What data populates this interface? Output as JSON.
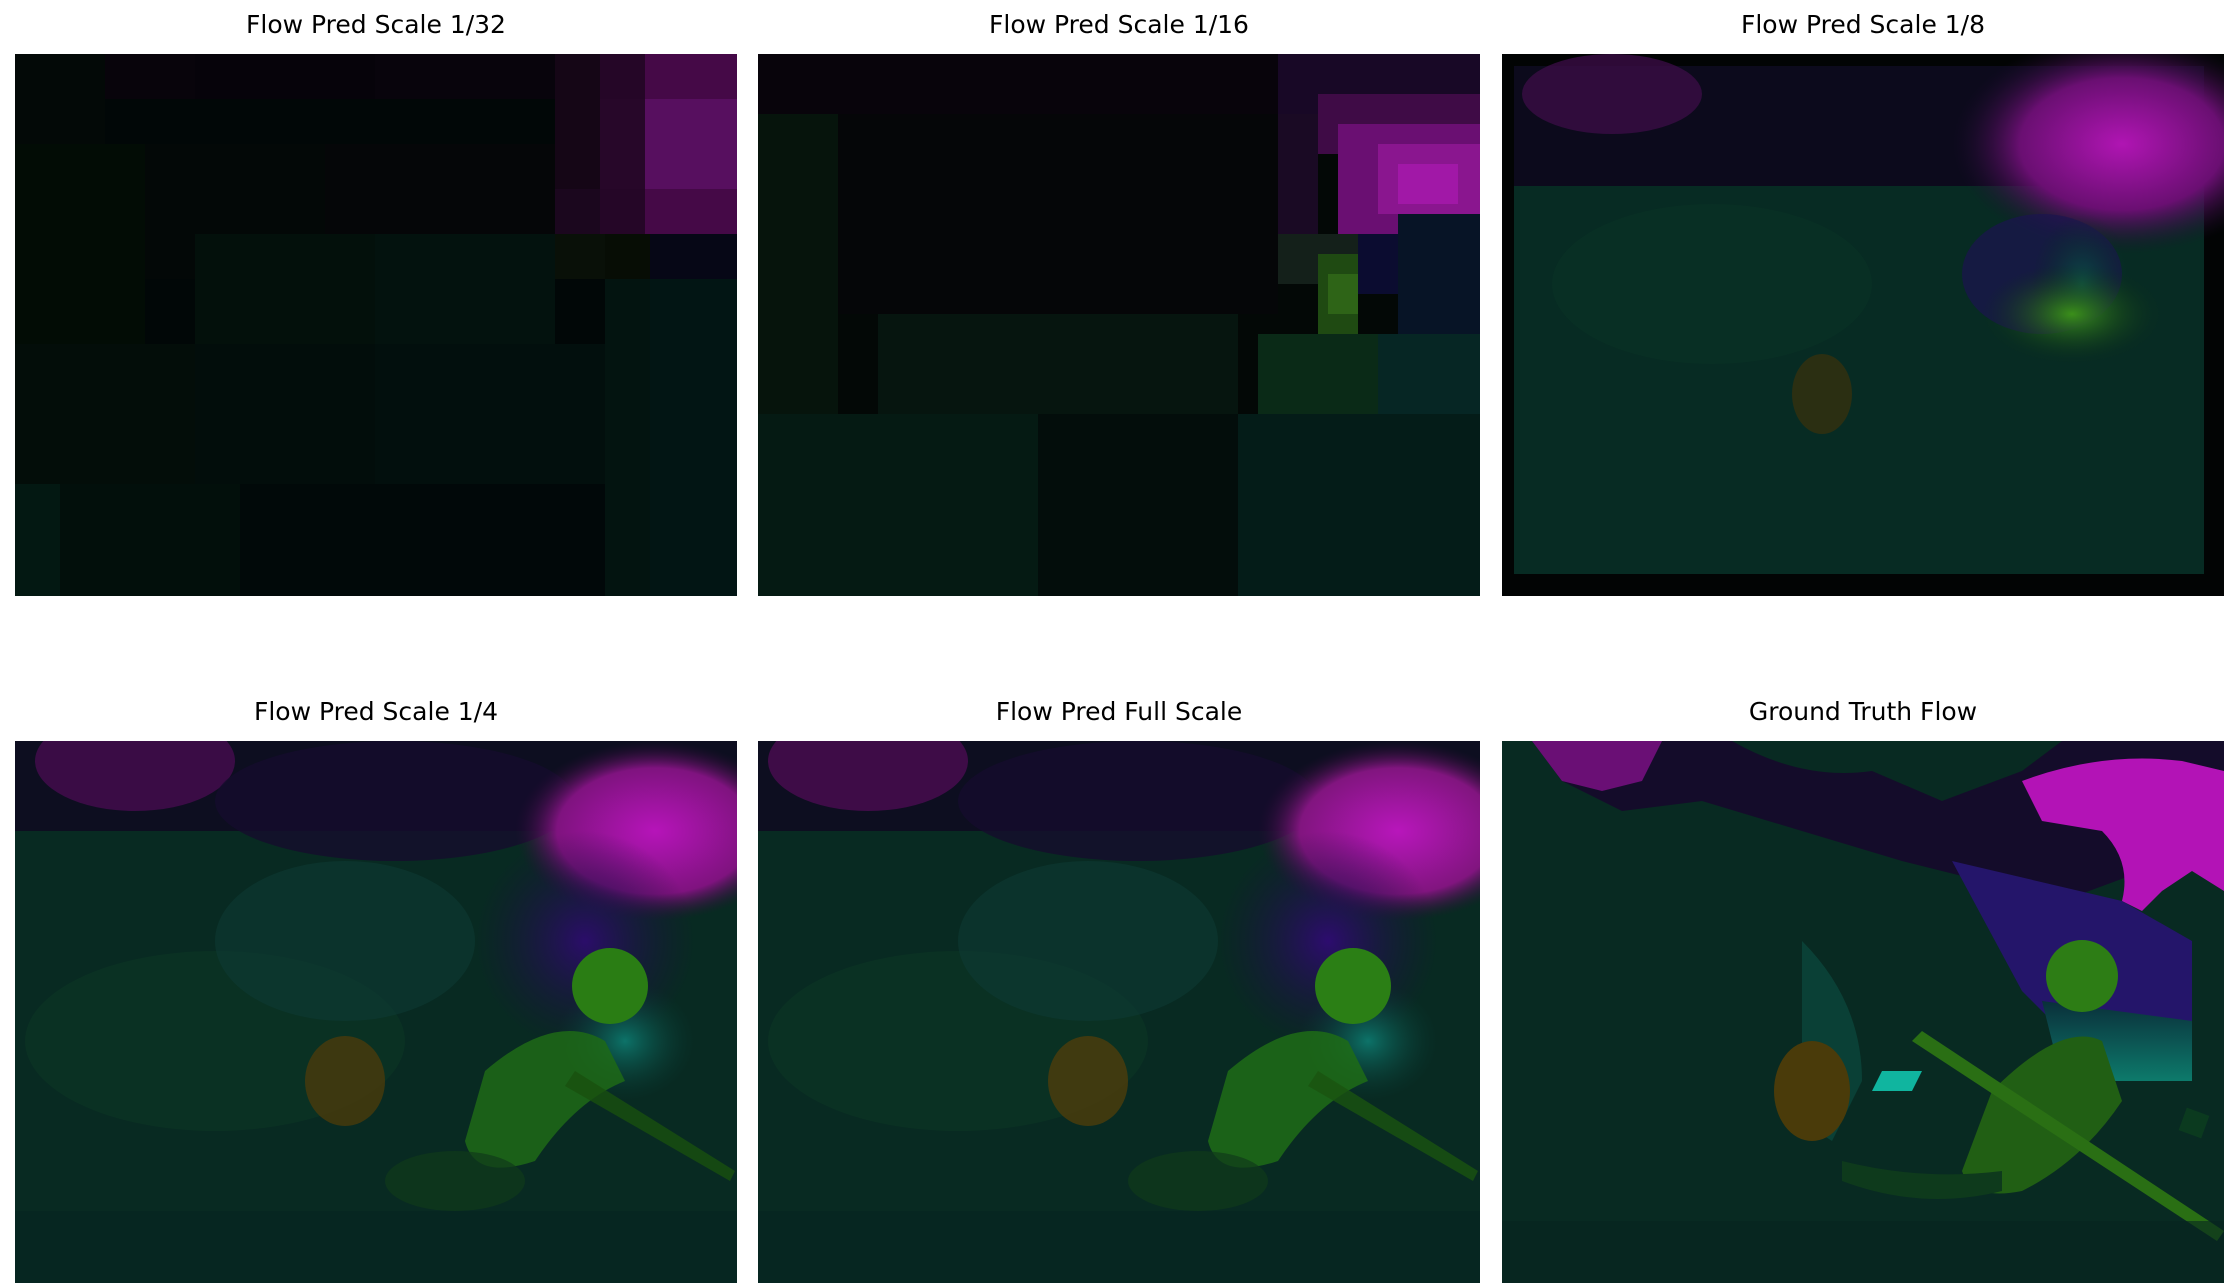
{
  "figure": {
    "panels": [
      {
        "title": "Flow Pred Scale 1/32",
        "image": "flow-visualization-scale-1-32"
      },
      {
        "title": "Flow Pred Scale 1/16",
        "image": "flow-visualization-scale-1-16"
      },
      {
        "title": "Flow Pred Scale 1/8",
        "image": "flow-visualization-scale-1-8"
      },
      {
        "title": "Flow Pred Scale 1/4",
        "image": "flow-visualization-scale-1-4"
      },
      {
        "title": "Flow Pred Full Scale",
        "image": "flow-visualization-full-scale"
      },
      {
        "title": "Ground Truth Flow",
        "image": "flow-visualization-ground-truth"
      }
    ]
  },
  "colors": {
    "background": "#ffffff",
    "flow_base": "#082a22",
    "flow_dark": "#020606",
    "flow_magenta": "#b012b8",
    "flow_green": "#2f8b17",
    "flow_teal": "#0b7066",
    "flow_indigo": "#270d69",
    "flow_orange": "#4b3a0a"
  }
}
